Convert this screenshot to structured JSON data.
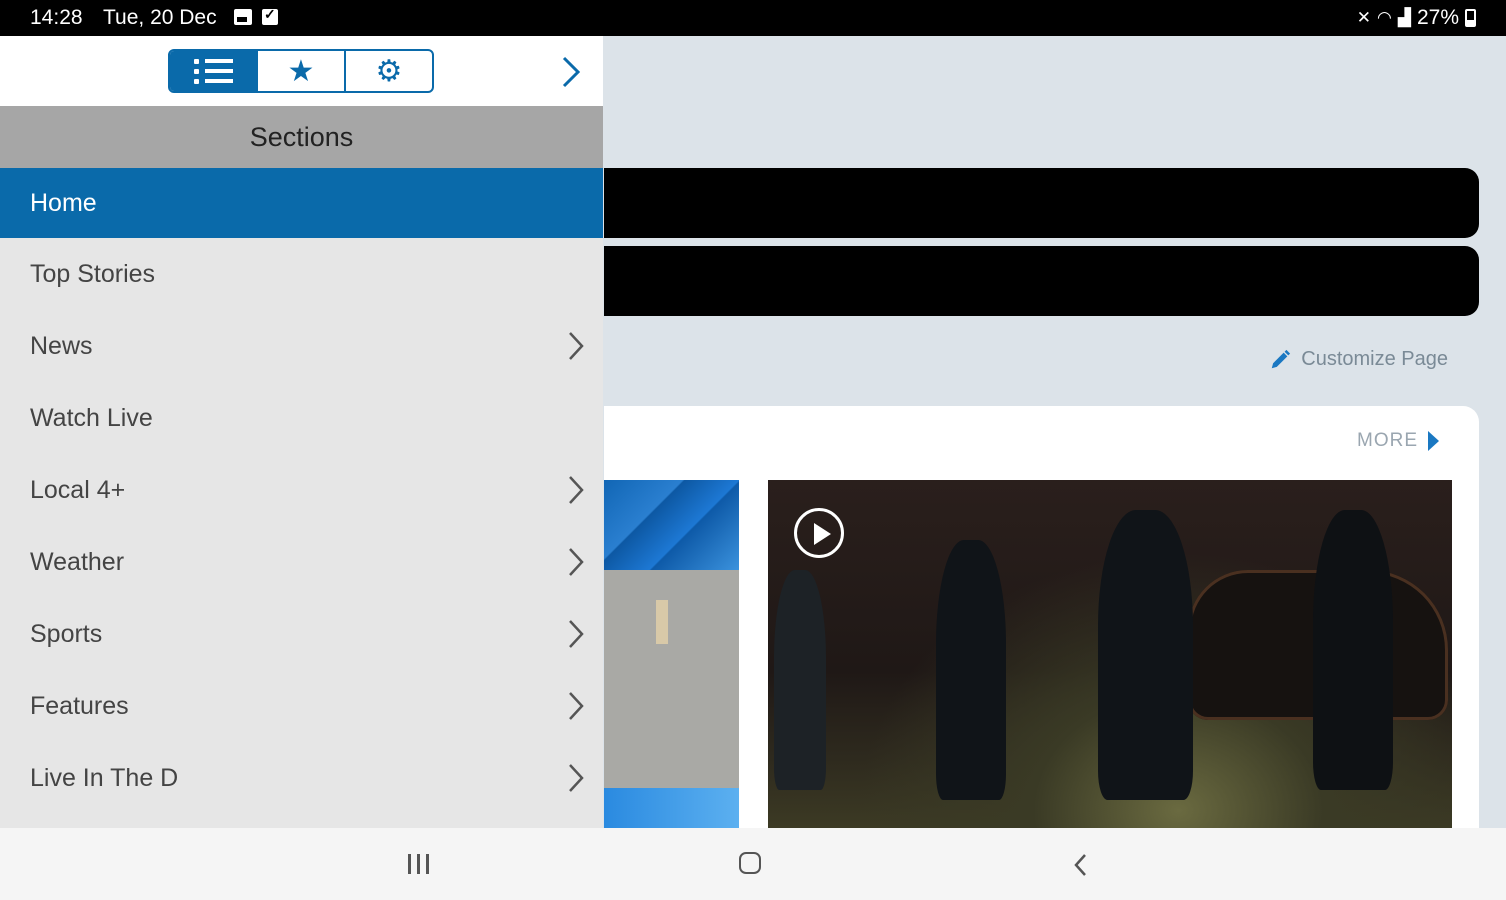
{
  "status_bar": {
    "time": "14:28",
    "date": "Tue, 20 Dec",
    "battery": "27%"
  },
  "drawer": {
    "title": "Sections",
    "tabs": [
      {
        "name": "sections-list",
        "active": true
      },
      {
        "name": "favorites",
        "active": false
      },
      {
        "name": "settings",
        "active": false
      }
    ],
    "items": [
      {
        "label": "Home",
        "active": true,
        "has_children": false
      },
      {
        "label": "Top Stories",
        "active": false,
        "has_children": false
      },
      {
        "label": "News",
        "active": false,
        "has_children": true
      },
      {
        "label": "Watch Live",
        "active": false,
        "has_children": false
      },
      {
        "label": "Local 4+",
        "active": false,
        "has_children": true
      },
      {
        "label": "Weather",
        "active": false,
        "has_children": true
      },
      {
        "label": "Sports",
        "active": false,
        "has_children": true
      },
      {
        "label": "Features",
        "active": false,
        "has_children": true
      },
      {
        "label": "Live In The D",
        "active": false,
        "has_children": true
      }
    ]
  },
  "main": {
    "customize_label": "Customize Page",
    "more_label": "MORE"
  },
  "colors": {
    "accent": "#0a6aaa",
    "status_bar": "#000000",
    "drawer_bg": "#e6e6e6",
    "sections_header": "#a6a6a6",
    "page_bg": "#dce3e9"
  }
}
